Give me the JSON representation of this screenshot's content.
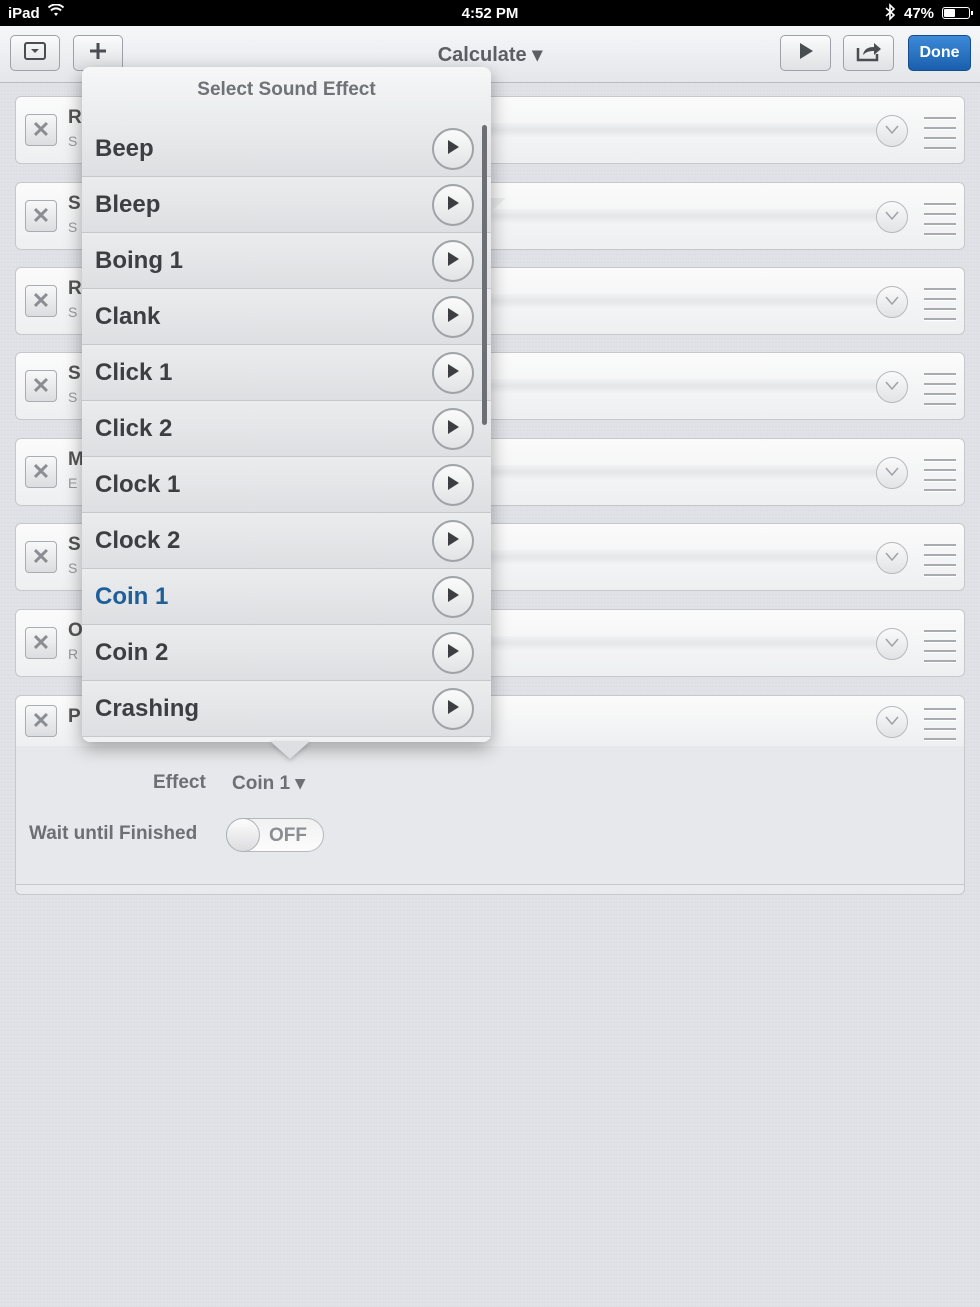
{
  "status_bar": {
    "carrier": "iPad",
    "time": "4:52 PM",
    "battery": "47%",
    "battery_level": 0.47
  },
  "toolbar": {
    "title": "Calculate ▾",
    "done_label": "Done"
  },
  "action_rows": [
    {
      "letter": "R",
      "sub": "S"
    },
    {
      "letter": "S",
      "sub": "S"
    },
    {
      "letter": "R",
      "sub": "S"
    },
    {
      "letter": "S",
      "sub": "S"
    },
    {
      "letter": "M",
      "sub": "E"
    },
    {
      "letter": "S",
      "sub": "S"
    },
    {
      "letter": "O",
      "sub": "R"
    }
  ],
  "expanded_row": {
    "letter": "P",
    "effect_label": "Effect",
    "effect_value": "Coin 1 ▾",
    "wait_label": "Wait until Finished",
    "toggle_text": "OFF"
  },
  "popover": {
    "title": "Select Sound Effect",
    "items": [
      "Beep",
      "Bleep",
      "Boing 1",
      "Clank",
      "Click 1",
      "Click 2",
      "Clock 1",
      "Clock 2",
      "Coin 1",
      "Coin 2",
      "Crashing"
    ],
    "selected": "Coin 1"
  },
  "colors": {
    "accent": "#1e5f99",
    "done_button": "#2672c4"
  }
}
